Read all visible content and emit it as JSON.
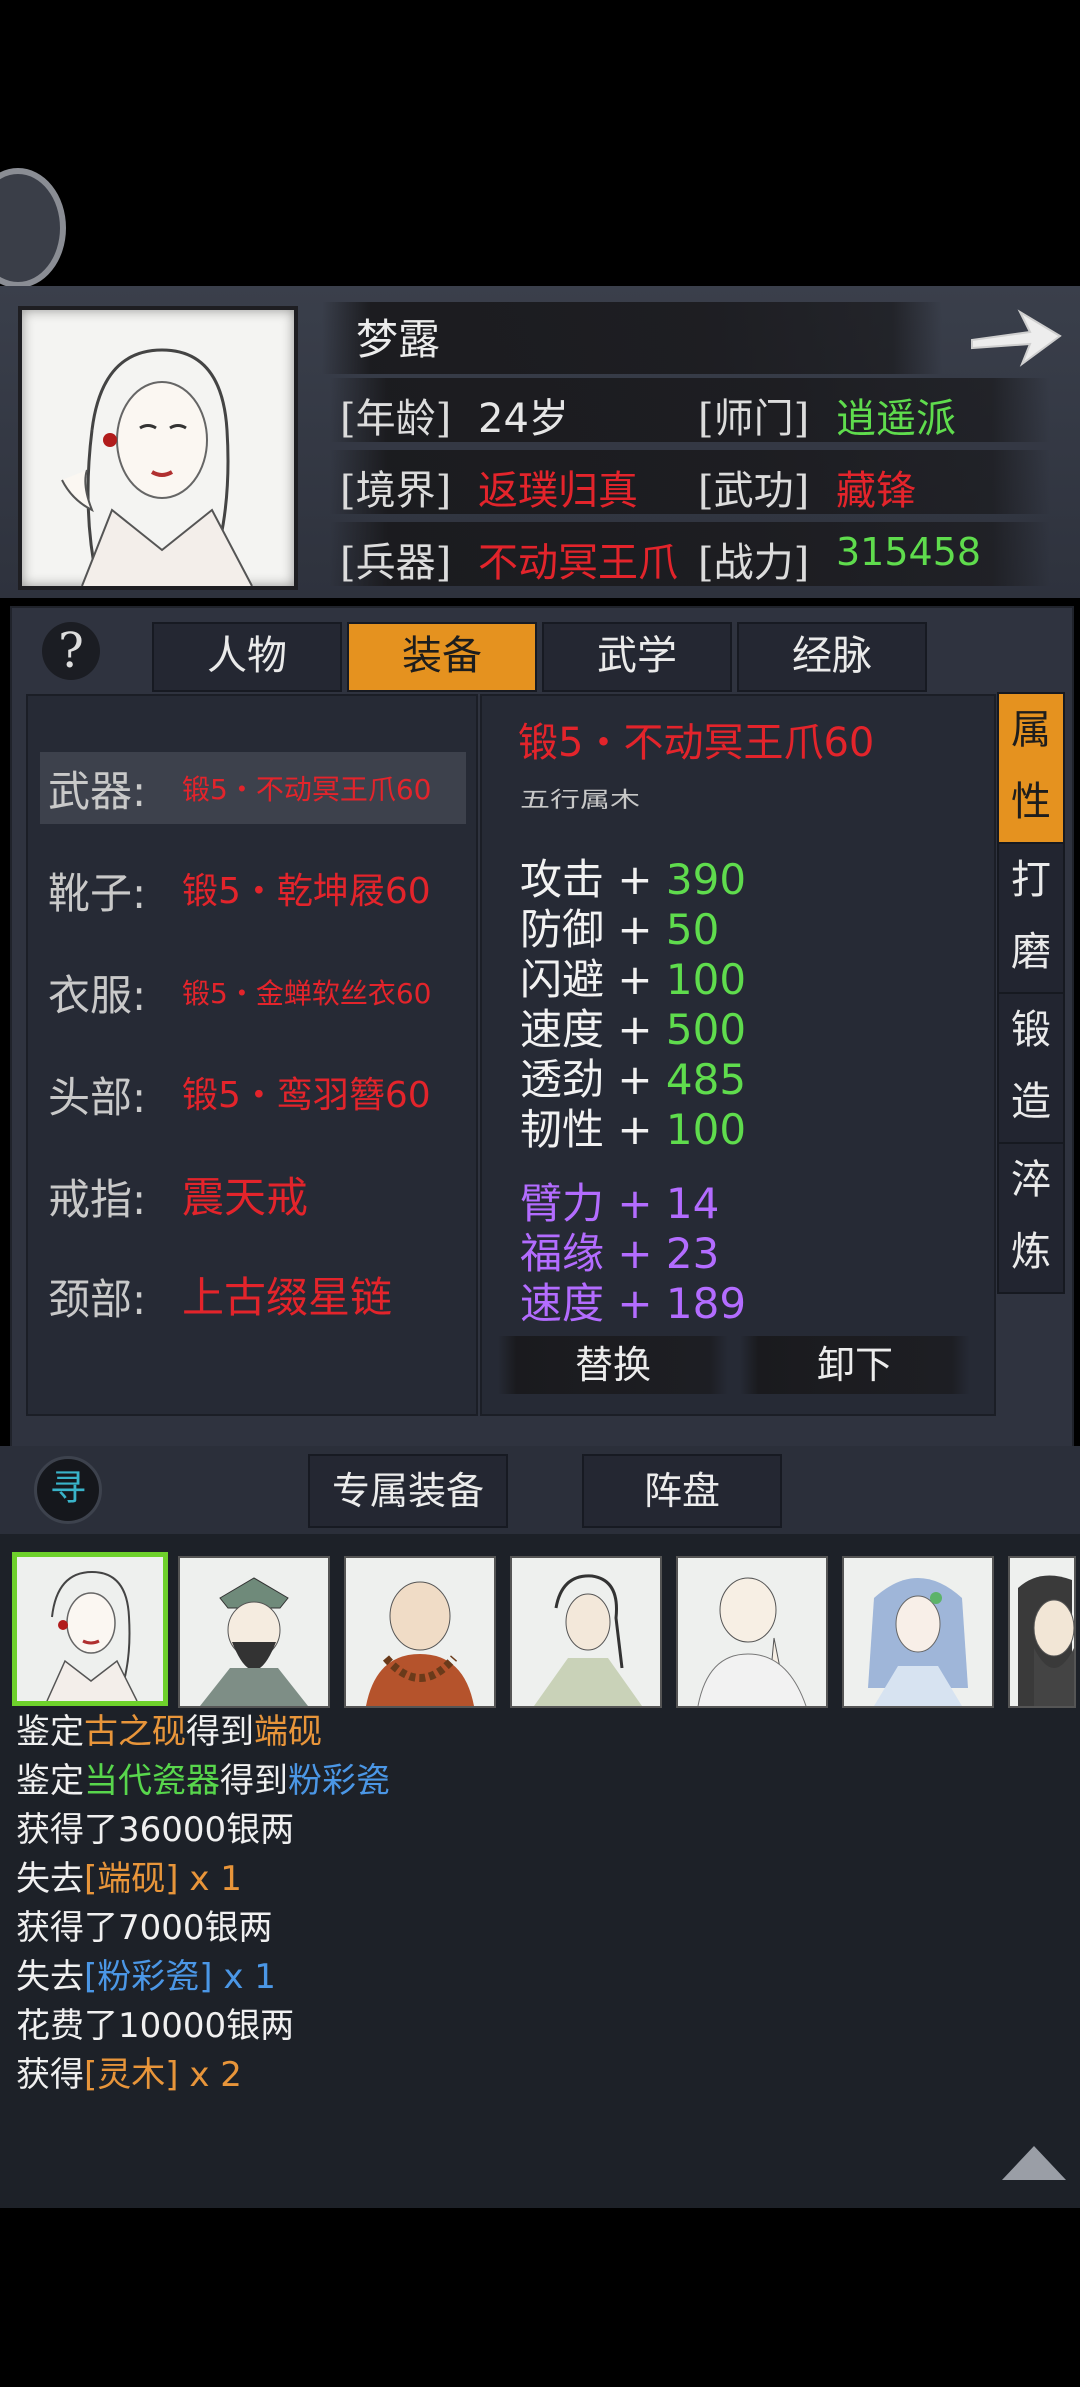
{
  "character": {
    "name": "梦露",
    "age_label": "[年龄]",
    "age_value": "24岁",
    "school_label": "[师门]",
    "school_value": "逍遥派",
    "realm_label": "[境界]",
    "realm_value": "返璞归真",
    "skill_label": "[武功]",
    "skill_value": "藏锋",
    "weapon_label": "[兵器]",
    "weapon_value": "不动冥王爪",
    "power_label": "[战力]",
    "power_value": "315458"
  },
  "tabs": [
    "人物",
    "装备",
    "武学",
    "经脉"
  ],
  "active_tab": "装备",
  "help_symbol": "?",
  "equipment_slots": [
    {
      "label": "武器:",
      "value": "锻5・不动冥王爪60"
    },
    {
      "label": "靴子:",
      "value": "锻5・乾坤屐60"
    },
    {
      "label": "衣服:",
      "value": "锻5・金蝉软丝衣60"
    },
    {
      "label": "头部:",
      "value": "锻5・鸾羽簪60"
    },
    {
      "label": "戒指:",
      "value": "震天戒"
    },
    {
      "label": "颈部:",
      "value": "上古缀星链"
    }
  ],
  "detail": {
    "title": "锻5・不动冥王爪60",
    "subtitle": "五行属木",
    "stats": [
      {
        "name": "攻击",
        "sign": " + ",
        "value": "390"
      },
      {
        "name": "防御",
        "sign": " + ",
        "value": "50"
      },
      {
        "name": "闪避",
        "sign": " + ",
        "value": "100"
      },
      {
        "name": "速度",
        "sign": " + ",
        "value": "500"
      },
      {
        "name": "透劲",
        "sign": " + ",
        "value": "485"
      },
      {
        "name": "韧性",
        "sign": " + ",
        "value": "100"
      }
    ],
    "bonus_stats": [
      {
        "name": "臂力",
        "sign": " + ",
        "value": "14"
      },
      {
        "name": "福缘",
        "sign": " + ",
        "value": "23"
      },
      {
        "name": "速度",
        "sign": " + ",
        "value": "189"
      }
    ],
    "replace_label": "替换",
    "unequip_label": "卸下"
  },
  "side_tabs": [
    {
      "label": "属性",
      "active": true
    },
    {
      "label": "打磨",
      "active": false
    },
    {
      "label": "锻造",
      "active": false
    },
    {
      "label": "淬炼",
      "active": false
    }
  ],
  "bottom_buttons": {
    "search_icon_char": "寻",
    "exclusive": "专属装备",
    "formation": "阵盘"
  },
  "log": [
    [
      {
        "t": "鉴定",
        "c": ""
      },
      {
        "t": "古之砚",
        "c": "orange"
      },
      {
        "t": "得到",
        "c": ""
      },
      {
        "t": "端砚",
        "c": "orange"
      }
    ],
    [
      {
        "t": "鉴定",
        "c": ""
      },
      {
        "t": "当代瓷器",
        "c": "green"
      },
      {
        "t": "得到",
        "c": ""
      },
      {
        "t": "粉彩瓷",
        "c": "blue"
      }
    ],
    [
      {
        "t": "获得了36000银两",
        "c": ""
      }
    ],
    [
      {
        "t": "失去",
        "c": ""
      },
      {
        "t": "[端砚] x 1",
        "c": "orange"
      }
    ],
    [
      {
        "t": "获得了7000银两",
        "c": ""
      }
    ],
    [
      {
        "t": "失去",
        "c": ""
      },
      {
        "t": "[粉彩瓷] x 1",
        "c": "blue"
      }
    ],
    [
      {
        "t": "花费了10000银两",
        "c": ""
      }
    ],
    [
      {
        "t": "获得",
        "c": ""
      },
      {
        "t": "[灵木] x 2",
        "c": "orange"
      }
    ]
  ],
  "colors": {
    "accent": "#e5921f",
    "red": "#e3242b",
    "green": "#5fdc4d",
    "purple": "#b36cff",
    "blue": "#4b97e6",
    "orange": "#e8953a"
  }
}
